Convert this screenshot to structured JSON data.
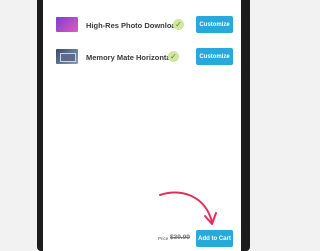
{
  "products": [
    {
      "name": "High-Res Photo Download",
      "check_icon": "check-circle-icon",
      "button": "Customize"
    },
    {
      "name": "Memory Mate Horizontal",
      "check_icon": "check-circle-icon",
      "button": "Customize"
    }
  ],
  "footer": {
    "price_label": "Price",
    "price": "$39.99",
    "add_to_cart": "Add to Cart"
  },
  "colors": {
    "accent": "#29a8dc",
    "arrow": "#e0315c",
    "check": "#cfe6a0"
  }
}
